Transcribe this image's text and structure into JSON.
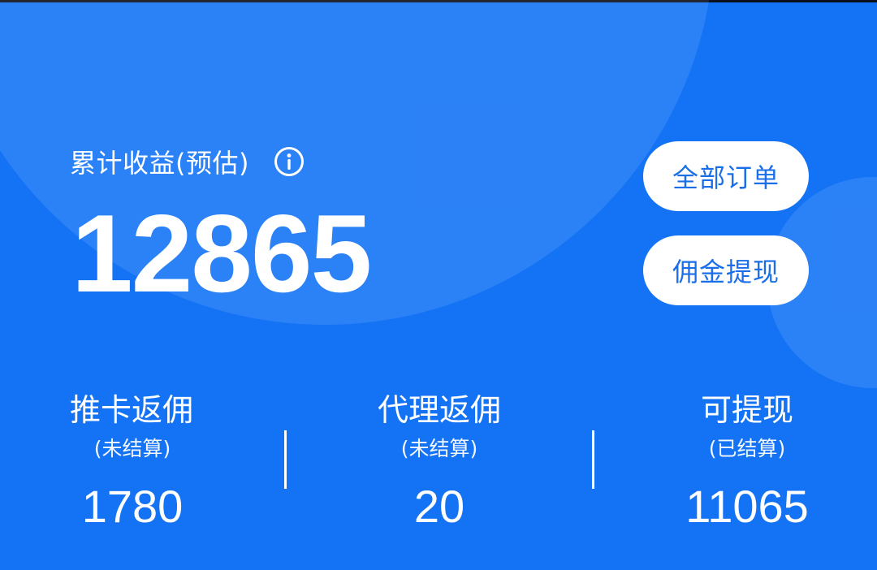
{
  "summary": {
    "label": "累计收益(预估)",
    "info_icon": "info-circle-icon",
    "total": "12865"
  },
  "actions": {
    "all_orders": "全部订单",
    "withdraw": "佣金提现"
  },
  "stats": [
    {
      "title": "推卡返佣",
      "subtitle": "(未结算)",
      "value": "1780"
    },
    {
      "title": "代理返佣",
      "subtitle": "(未结算)",
      "value": "20"
    },
    {
      "title": "可提现",
      "subtitle": "(已结算)",
      "value": "11065"
    }
  ],
  "colors": {
    "background": "#1473f5",
    "button_bg": "#ffffff",
    "button_text": "#1a6fe8",
    "text": "#ffffff"
  }
}
